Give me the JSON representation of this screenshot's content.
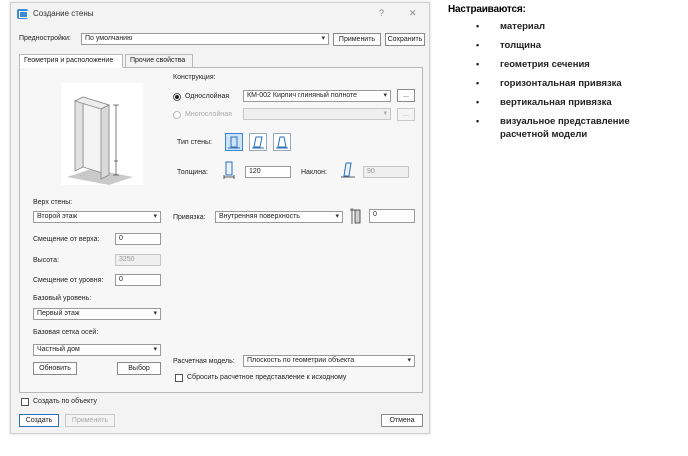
{
  "window": {
    "title": "Создание стены",
    "help_glyph": "?",
    "close_glyph": "✕"
  },
  "presets": {
    "label": "Предностройки:",
    "value": "По умолчанию",
    "apply_label": "Применить",
    "save_label": "Сохранить"
  },
  "tabs": [
    {
      "label": "Геометрия и расположение"
    },
    {
      "label": "Прочие свойства"
    }
  ],
  "left": {
    "top_label": "Верх стены:",
    "top_value": "Второй этаж",
    "offset_top_label": "Смещение от верха:",
    "offset_top_value": "0",
    "height_label": "Высота:",
    "height_value": "3250",
    "offset_level_label": "Смещение от уровня:",
    "offset_level_value": "0",
    "base_level_label": "Базовый уровень:",
    "base_level_value": "Первый этаж",
    "grid_label": "Базовая сетка осей:",
    "grid_value": "Частный дом",
    "refresh_label": "Обновить",
    "select_label": "Выбор"
  },
  "construction": {
    "label": "Конструкция:",
    "single_label": "Однослойная",
    "single_value": "КМ-002 Кирпич глиняный полноте",
    "multi_label": "Многослойная",
    "multi_value": "",
    "more_glyph": "..."
  },
  "wall_type": {
    "label": "Тип стены:"
  },
  "thickness": {
    "label": "Толщина:",
    "value": "120",
    "tilt_label": "Наклон:",
    "tilt_value": "90"
  },
  "binding": {
    "label": "Привязка:",
    "value": "Внутренняя поверхность",
    "offset_value": "0"
  },
  "calc_model": {
    "label": "Расчетная модель:",
    "value": "Плоскость по геометрии объекта",
    "reset_label": "Сбросить расчетное представление к исходному"
  },
  "footer": {
    "create_by_object_label": "Создать по объекту",
    "create_label": "Создать",
    "apply_label": "Применить",
    "cancel_label": "Отмена"
  },
  "notes": {
    "title": "Настраиваются:",
    "items": [
      "материал",
      "толщина",
      "геометрия сечения",
      "горизонтальная привязка",
      "вертикальная привязка",
      "визуальное представление",
      "расчетной модели"
    ]
  },
  "colors": {
    "accent": "#3a86d6",
    "selected_fill": "#cfe3f6"
  }
}
